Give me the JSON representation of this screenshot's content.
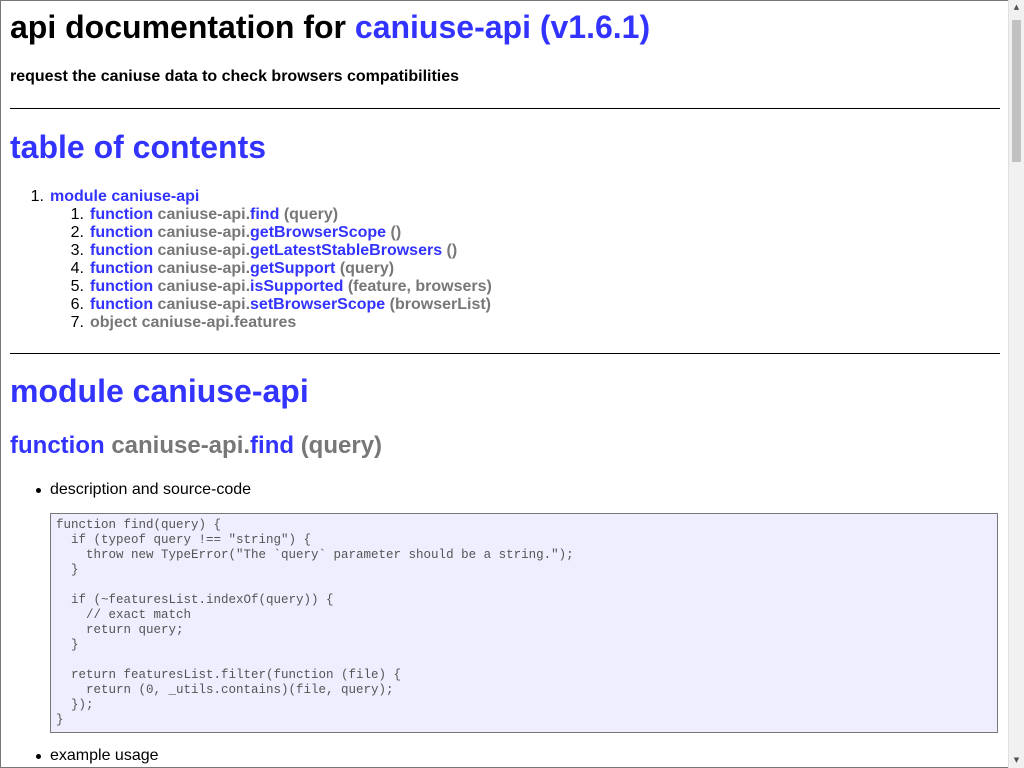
{
  "header": {
    "title_prefix": "api documentation for",
    "title_link": "caniuse-api (v1.6.1)",
    "subtitle": "request the caniuse data to check browsers compatibilities"
  },
  "toc": {
    "title": "table of contents",
    "module": {
      "num": "1.",
      "label": "module caniuse-api"
    },
    "items": [
      {
        "num": "1.",
        "kind": "function",
        "prefix": "caniuse-api.",
        "name": "find",
        "args": "(query)"
      },
      {
        "num": "2.",
        "kind": "function",
        "prefix": "caniuse-api.",
        "name": "getBrowserScope",
        "args": "()"
      },
      {
        "num": "3.",
        "kind": "function",
        "prefix": "caniuse-api.",
        "name": "getLatestStableBrowsers",
        "args": "()"
      },
      {
        "num": "4.",
        "kind": "function",
        "prefix": "caniuse-api.",
        "name": "getSupport",
        "args": "(query)"
      },
      {
        "num": "5.",
        "kind": "function",
        "prefix": "caniuse-api.",
        "name": "isSupported",
        "args": "(feature, browsers)"
      },
      {
        "num": "6.",
        "kind": "function",
        "prefix": "caniuse-api.",
        "name": "setBrowserScope",
        "args": "(browserList)"
      },
      {
        "num": "7.",
        "kind": "",
        "prefix": "object caniuse-api.features",
        "name": "",
        "args": ""
      }
    ]
  },
  "module_section": {
    "title": "module caniuse-api",
    "function": {
      "kind": "function",
      "prefix": "caniuse-api.",
      "name": "find",
      "args": "(query)"
    },
    "bullet_description": "description and source-code",
    "source_code": "function find(query) {\n  if (typeof query !== \"string\") {\n    throw new TypeError(\"The `query` parameter should be a string.\");\n  }\n\n  if (~featuresList.indexOf(query)) {\n    // exact match\n    return query;\n  }\n\n  return featuresList.filter(function (file) {\n    return (0, _utils.contains)(file, query);\n  });\n}",
    "bullet_example": "example usage"
  },
  "colors": {
    "link": "#3333ff",
    "muted": "#777777",
    "code_bg": "#eeeeff"
  }
}
